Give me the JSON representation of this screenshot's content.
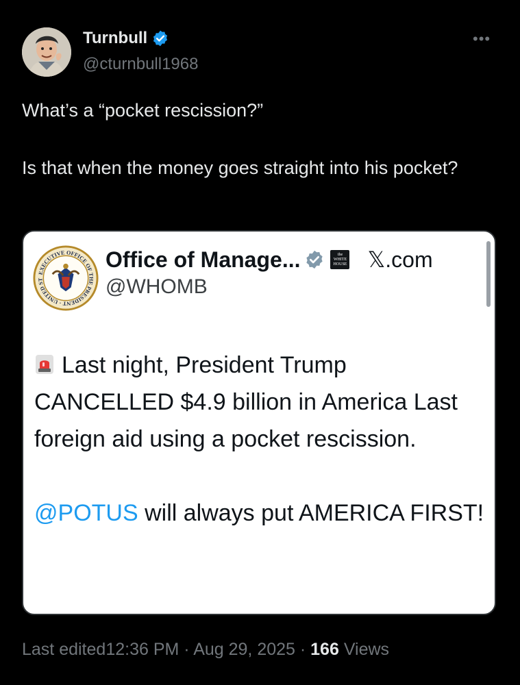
{
  "author": {
    "name": "Turnbull",
    "handle": "@cturnbull1968",
    "verified": true,
    "avatar_icon": "avatar-caricature"
  },
  "tweet": {
    "line1": "What’s a “pocket rescission?”",
    "line2": "Is that when the money goes straight into his pocket?"
  },
  "more_icon": "•••",
  "quoted": {
    "name": "Office of Manage...",
    "handle": "@WHOMB",
    "site": "𝕏.com",
    "seal_icon": "executive-office-seal",
    "badge_icon": "white-house-badge",
    "badge_text_top": "the",
    "badge_text_mid": "WHITE",
    "badge_text_bot": "HOUSE",
    "text_main": "Last night, President Trump CANCELLED $4.9 billion in America Last foreign aid using a pocket rescission.",
    "mention": "@POTUS",
    "text_tail": " will always put AMERICA FIRST!"
  },
  "meta": {
    "edited": "Last edited",
    "time": "12:36 PM",
    "sep1": " · ",
    "date": "Aug 29, 2025",
    "sep2": " · ",
    "views_count": "166",
    "views_label": " Views"
  },
  "colors": {
    "background": "#000000",
    "verified": "#1d9bf0",
    "mention": "#1d9bf0",
    "gov_badge": "#829aab"
  }
}
